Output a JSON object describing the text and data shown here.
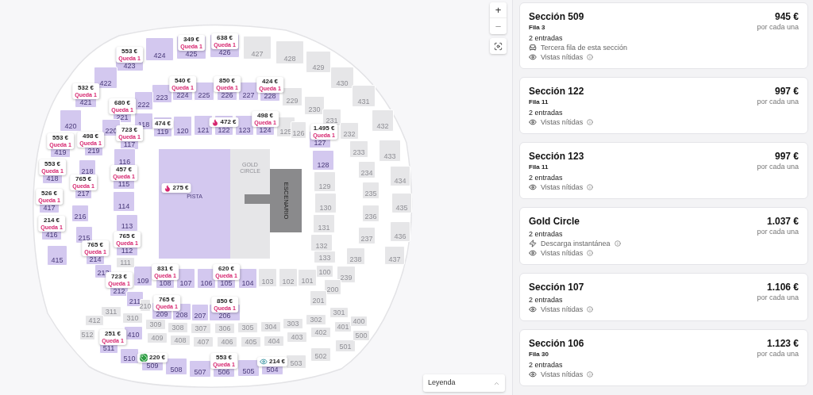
{
  "map": {
    "sections": [
      {
        "label": "423",
        "available": true
      },
      {
        "label": "424",
        "available": true
      },
      {
        "label": "425",
        "available": true
      },
      {
        "label": "426",
        "available": true
      },
      {
        "label": "427",
        "available": false
      },
      {
        "label": "428",
        "available": false
      },
      {
        "label": "429",
        "available": false
      },
      {
        "label": "430",
        "available": false
      },
      {
        "label": "431",
        "available": false
      },
      {
        "label": "432",
        "available": false
      },
      {
        "label": "433",
        "available": false
      },
      {
        "label": "434",
        "available": false
      },
      {
        "label": "435",
        "available": false
      },
      {
        "label": "436",
        "available": false
      },
      {
        "label": "437",
        "available": false
      },
      {
        "label": "422",
        "available": true
      },
      {
        "label": "421",
        "available": true
      },
      {
        "label": "420",
        "available": true
      },
      {
        "label": "419",
        "available": true
      },
      {
        "label": "418",
        "available": true
      },
      {
        "label": "417",
        "available": true
      },
      {
        "label": "416",
        "available": true
      },
      {
        "label": "415",
        "available": true
      },
      {
        "label": "311",
        "available": false
      },
      {
        "label": "310",
        "available": false
      },
      {
        "label": "309",
        "available": false
      },
      {
        "label": "308",
        "available": false
      },
      {
        "label": "307",
        "available": false
      },
      {
        "label": "306",
        "available": false
      },
      {
        "label": "305",
        "available": false
      },
      {
        "label": "304",
        "available": false
      },
      {
        "label": "303",
        "available": false
      },
      {
        "label": "302",
        "available": false
      },
      {
        "label": "301",
        "available": false
      },
      {
        "label": "412",
        "available": false
      },
      {
        "label": "410",
        "available": true
      },
      {
        "label": "409",
        "available": false
      },
      {
        "label": "408",
        "available": false
      },
      {
        "label": "407",
        "available": false
      },
      {
        "label": "406",
        "available": false
      },
      {
        "label": "405",
        "available": false
      },
      {
        "label": "404",
        "available": false
      },
      {
        "label": "403",
        "available": false
      },
      {
        "label": "402",
        "available": false
      },
      {
        "label": "401",
        "available": false
      },
      {
        "label": "400",
        "available": false
      },
      {
        "label": "512",
        "available": false
      },
      {
        "label": "511",
        "available": true
      },
      {
        "label": "510",
        "available": true
      },
      {
        "label": "509",
        "available": true
      },
      {
        "label": "508",
        "available": true
      },
      {
        "label": "507",
        "available": true
      },
      {
        "label": "506",
        "available": true
      },
      {
        "label": "505",
        "available": true
      },
      {
        "label": "504",
        "available": true
      },
      {
        "label": "503",
        "available": false
      },
      {
        "label": "502",
        "available": false
      },
      {
        "label": "501",
        "available": false
      },
      {
        "label": "500",
        "available": false
      },
      {
        "label": "223",
        "available": true
      },
      {
        "label": "224",
        "available": true
      },
      {
        "label": "225",
        "available": true
      },
      {
        "label": "226",
        "available": true
      },
      {
        "label": "227",
        "available": true
      },
      {
        "label": "228",
        "available": true
      },
      {
        "label": "229",
        "available": false
      },
      {
        "label": "230",
        "available": false
      },
      {
        "label": "231",
        "available": false
      },
      {
        "label": "232",
        "available": false
      },
      {
        "label": "233",
        "available": false
      },
      {
        "label": "234",
        "available": false
      },
      {
        "label": "235",
        "available": false
      },
      {
        "label": "236",
        "available": false
      },
      {
        "label": "237",
        "available": false
      },
      {
        "label": "238",
        "available": false
      },
      {
        "label": "239",
        "available": false
      },
      {
        "label": "200",
        "available": false
      },
      {
        "label": "201",
        "available": false
      },
      {
        "label": "222",
        "available": true
      },
      {
        "label": "221",
        "available": true
      },
      {
        "label": "220",
        "available": true
      },
      {
        "label": "219",
        "available": true
      },
      {
        "label": "218",
        "available": true
      },
      {
        "label": "217",
        "available": true
      },
      {
        "label": "216",
        "available": true
      },
      {
        "label": "215",
        "available": true
      },
      {
        "label": "214",
        "available": true
      },
      {
        "label": "213",
        "available": true
      },
      {
        "label": "212",
        "available": true
      },
      {
        "label": "211",
        "available": true
      },
      {
        "label": "210",
        "available": false
      },
      {
        "label": "209",
        "available": true
      },
      {
        "label": "208",
        "available": true
      },
      {
        "label": "207",
        "available": true
      },
      {
        "label": "206",
        "available": true
      },
      {
        "label": "117",
        "available": true
      },
      {
        "label": "118",
        "available": true
      },
      {
        "label": "119",
        "available": true
      },
      {
        "label": "120",
        "available": true
      },
      {
        "label": "121",
        "available": true
      },
      {
        "label": "122",
        "available": true
      },
      {
        "label": "123",
        "available": true
      },
      {
        "label": "124",
        "available": true
      },
      {
        "label": "125",
        "available": false
      },
      {
        "label": "126",
        "available": false
      },
      {
        "label": "127",
        "available": true
      },
      {
        "label": "128",
        "available": true
      },
      {
        "label": "129",
        "available": false
      },
      {
        "label": "130",
        "available": false
      },
      {
        "label": "131",
        "available": false
      },
      {
        "label": "132",
        "available": false
      },
      {
        "label": "133",
        "available": false
      },
      {
        "label": "109",
        "available": true
      },
      {
        "label": "108",
        "available": true
      },
      {
        "label": "107",
        "available": true
      },
      {
        "label": "106",
        "available": true
      },
      {
        "label": "105",
        "available": true
      },
      {
        "label": "104",
        "available": true
      },
      {
        "label": "103",
        "available": false
      },
      {
        "label": "102",
        "available": false
      },
      {
        "label": "101",
        "available": false
      },
      {
        "label": "100",
        "available": false
      },
      {
        "label": "116",
        "available": true
      },
      {
        "label": "115",
        "available": true
      },
      {
        "label": "114",
        "available": true
      },
      {
        "label": "113",
        "available": true
      },
      {
        "label": "112",
        "available": true
      },
      {
        "label": "111",
        "available": false
      }
    ],
    "field": {
      "pista": "PISTA",
      "gold_circle": "GOLD CIRCLE",
      "stage": "ESCENARIO"
    },
    "pins": [
      {
        "kind": "queda",
        "price": "349 €",
        "note": "Queda 1"
      },
      {
        "kind": "queda",
        "price": "638 €",
        "note": "Queda 1"
      },
      {
        "kind": "queda",
        "price": "553 €",
        "note": "Queda 1"
      },
      {
        "kind": "queda",
        "price": "532 €",
        "note": "Queda 1"
      },
      {
        "kind": "queda",
        "price": "540 €",
        "note": "Queda 1"
      },
      {
        "kind": "queda",
        "price": "850 €",
        "note": "Queda 1"
      },
      {
        "kind": "queda",
        "price": "424 €",
        "note": "Queda 1"
      },
      {
        "kind": "queda",
        "price": "680 €",
        "note": "Queda 1"
      },
      {
        "kind": "plain",
        "price": "474 €"
      },
      {
        "kind": "hot",
        "price": "472 €"
      },
      {
        "kind": "queda",
        "price": "498 €",
        "note": "Queda 1"
      },
      {
        "kind": "queda",
        "price": "553 €",
        "note": "Queda 1"
      },
      {
        "kind": "queda",
        "price": "498 €",
        "note": "Queda 1"
      },
      {
        "kind": "queda",
        "price": "723 €",
        "note": "Queda 1"
      },
      {
        "kind": "queda",
        "price": "1.495 €",
        "note": "Queda 1"
      },
      {
        "kind": "queda",
        "price": "553 €",
        "note": "Queda 1"
      },
      {
        "kind": "queda",
        "price": "765 €",
        "note": "Queda 1"
      },
      {
        "kind": "queda",
        "price": "457 €",
        "note": "Queda 1"
      },
      {
        "kind": "queda",
        "price": "526 €",
        "note": "Queda 1"
      },
      {
        "kind": "hot",
        "price": "275 €"
      },
      {
        "kind": "queda",
        "price": "214 €",
        "note": "Queda 1"
      },
      {
        "kind": "queda",
        "price": "765 €",
        "note": "Queda 1"
      },
      {
        "kind": "queda",
        "price": "765 €",
        "note": "Queda 1"
      },
      {
        "kind": "queda",
        "price": "831 €",
        "note": "Queda 1"
      },
      {
        "kind": "queda",
        "price": "620 €",
        "note": "Queda 1"
      },
      {
        "kind": "queda",
        "price": "723 €",
        "note": "Queda 1"
      },
      {
        "kind": "queda",
        "price": "765 €",
        "note": "Queda 1"
      },
      {
        "kind": "queda",
        "price": "850 €",
        "note": "Queda 1"
      },
      {
        "kind": "queda",
        "price": "251 €",
        "note": "Queda 1"
      },
      {
        "kind": "deal",
        "price": "220 €"
      },
      {
        "kind": "queda",
        "price": "553 €",
        "note": "Queda 1"
      },
      {
        "kind": "view",
        "price": "214 €"
      }
    ]
  },
  "zoom_controls": {
    "zoom_in": "+",
    "zoom_out": "−"
  },
  "legend": {
    "label": "Leyenda"
  },
  "listings": [
    {
      "title": "Sección 509",
      "row": "Fila 3",
      "tickets": "2 entradas",
      "price": "945 €",
      "per": "por cada una",
      "features": [
        {
          "kind": "row",
          "text": "Tercera fila de esta sección",
          "info": false
        },
        {
          "kind": "view",
          "text": "Vistas nítidas",
          "info": true
        }
      ]
    },
    {
      "title": "Sección 122",
      "row": "Fila 11",
      "tickets": "2 entradas",
      "price": "997 €",
      "per": "por cada una",
      "features": [
        {
          "kind": "view",
          "text": "Vistas nítidas",
          "info": true
        }
      ]
    },
    {
      "title": "Sección 123",
      "row": "Fila 11",
      "tickets": "2 entradas",
      "price": "997 €",
      "per": "por cada una",
      "features": [
        {
          "kind": "view",
          "text": "Vistas nítidas",
          "info": true
        }
      ]
    },
    {
      "title": "Gold Circle",
      "tickets": "2 entradas",
      "price": "1.037 €",
      "per": "por cada una",
      "features": [
        {
          "kind": "download",
          "text": "Descarga instantánea",
          "info": true
        },
        {
          "kind": "view",
          "text": "Vistas nítidas",
          "info": true
        }
      ]
    },
    {
      "title": "Sección 107",
      "tickets": "2 entradas",
      "price": "1.106 €",
      "per": "por cada una",
      "features": [
        {
          "kind": "view",
          "text": "Vistas nítidas",
          "info": true
        }
      ]
    },
    {
      "title": "Sección 106",
      "row": "Fila 30",
      "tickets": "2 entradas",
      "price": "1.123 €",
      "per": "por cada una",
      "features": [
        {
          "kind": "view",
          "text": "Vistas nítidas",
          "info": true
        }
      ]
    }
  ]
}
